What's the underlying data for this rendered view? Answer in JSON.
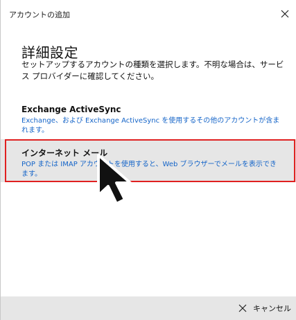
{
  "window": {
    "title": "アカウントの追加"
  },
  "main": {
    "heading": "詳細設定",
    "description": "セットアップするアカウントの種類を選択します。不明な場合は、サービス プロバイダーに確認してください。"
  },
  "options": [
    {
      "title": "Exchange ActiveSync",
      "description": "Exchange、および Exchange ActiveSync を使用するその他のアカウントが含まれます。"
    },
    {
      "title": "インターネット メール",
      "description": "POP または IMAP アカウントを使用すると、Web ブラウザーでメールを表示できます。"
    }
  ],
  "footer": {
    "cancel_label": "キャンセル"
  },
  "colors": {
    "link_blue": "#1464c8",
    "highlight_red": "#e02020",
    "selected_bg": "#e6e6e6"
  },
  "icons": {
    "close": "close-icon",
    "cancel": "close-icon",
    "pointer": "mouse-pointer-icon"
  }
}
